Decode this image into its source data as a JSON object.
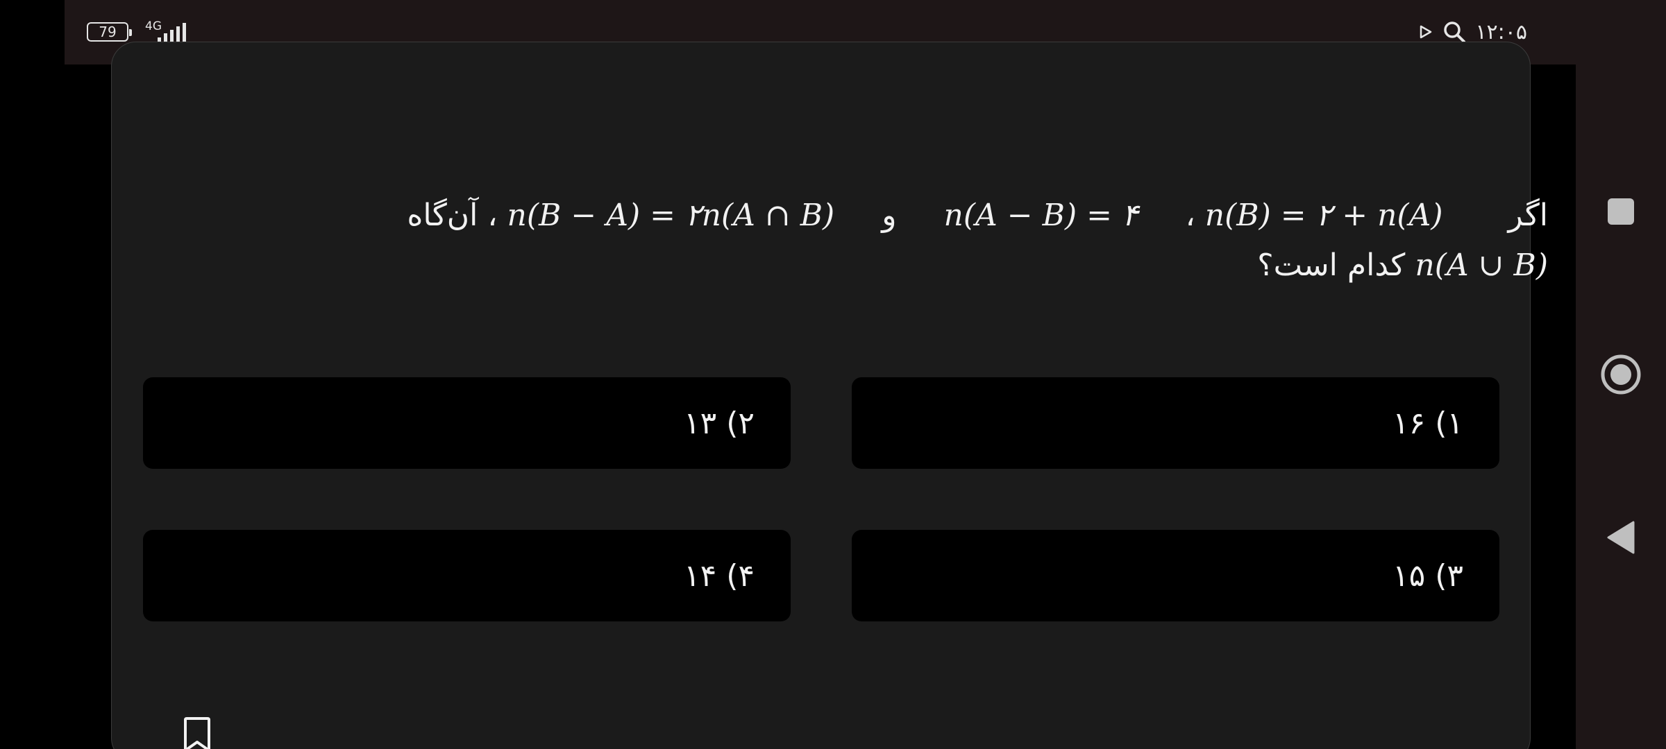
{
  "status_bar": {
    "battery_level": "79",
    "network_type": "4G",
    "signal_bars": 5,
    "clock": "۱۲:۰۵",
    "icons": [
      "battery-icon",
      "signal-icon",
      "search-icon",
      "play-store-icon"
    ]
  },
  "question": {
    "line1": {
      "word_if": "اگر",
      "expr1": "n(B) = ۲ + n(A)",
      "comma1": "،",
      "expr2": "n(A − B) = ۴",
      "word_and": "و",
      "expr3": "n(B − A) = ۲n(A ∩ B)",
      "comma2": "،",
      "word_then": "آن‌گاه"
    },
    "line2": {
      "expr4": "n(A ∪ B)",
      "text": "کدام است؟"
    }
  },
  "options": [
    {
      "label": "۱) ۱۶"
    },
    {
      "label": "۲) ۱۳"
    },
    {
      "label": "۳) ۱۵"
    },
    {
      "label": "۴) ۱۴"
    }
  ],
  "colors": {
    "background": "#000000",
    "card": "#1b1b1b",
    "status_bar": "#1e1617",
    "text": "#f2f2f2"
  },
  "navigation": {
    "icons": [
      "recent-apps-icon",
      "home-icon",
      "back-icon"
    ]
  }
}
